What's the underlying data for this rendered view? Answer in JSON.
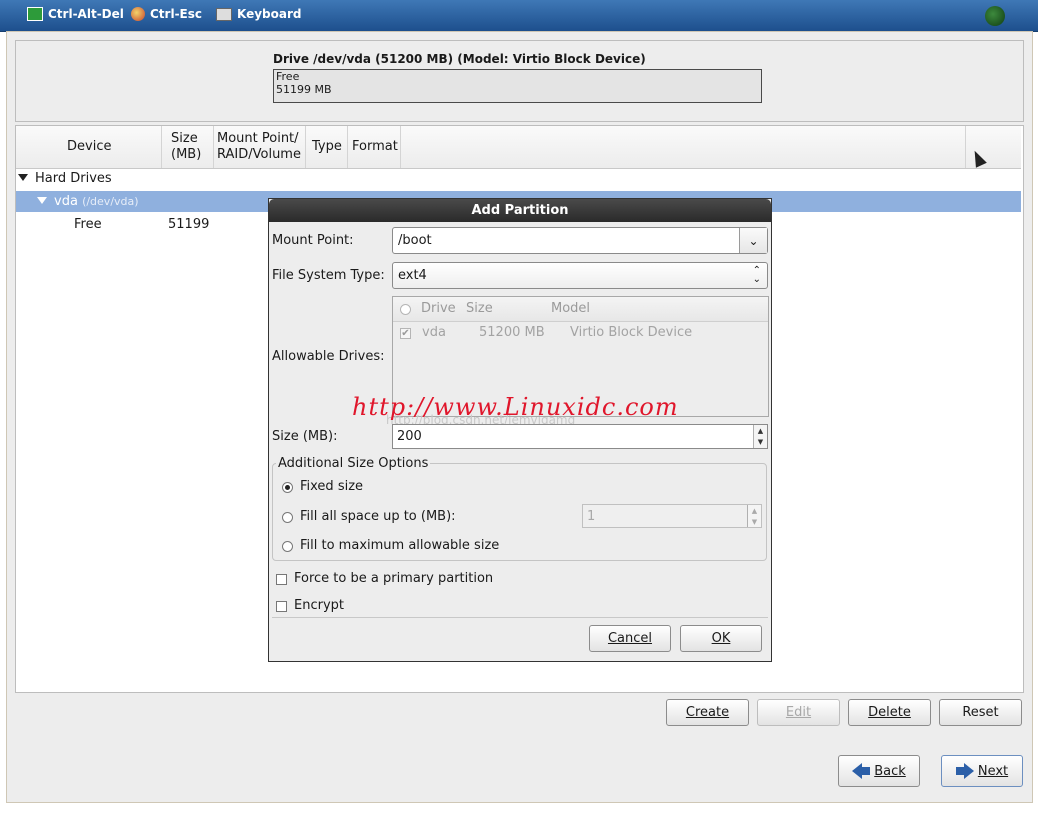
{
  "toolbar": {
    "items": [
      {
        "label": "Ctrl-Alt-Del",
        "icon": "monitor-icon"
      },
      {
        "label": "Ctrl-Esc",
        "icon": "windows-flag-icon"
      },
      {
        "label": "Keyboard",
        "icon": "keyboard-icon"
      }
    ],
    "status_icon": "connection-status-icon"
  },
  "drive": {
    "title": "Drive /dev/vda (51200 MB) (Model: Virtio Block Device)",
    "bar_label": "Free",
    "bar_size": "51199 MB"
  },
  "table": {
    "columns": [
      "Device",
      "Size\n(MB)",
      "Mount Point/\nRAID/Volume",
      "Type",
      "Format"
    ],
    "group": "Hard Drives",
    "disk": {
      "name": "vda",
      "path": "(/dev/vda)"
    },
    "free_row": {
      "device": "Free",
      "size": "51199"
    }
  },
  "dialog": {
    "title": "Add Partition",
    "mount_point_label": "Mount Point:",
    "mount_point_value": "/boot",
    "fs_type_label": "File System Type:",
    "fs_type_value": "ext4",
    "allowable_drives_label": "Allowable Drives:",
    "drives_columns": [
      "Drive",
      "Size",
      "Model"
    ],
    "drives": [
      {
        "drive": "vda",
        "size": "51200 MB",
        "model": "Virtio Block Device",
        "checked": true
      }
    ],
    "size_label": "Size (MB):",
    "size_value": "200",
    "size_options_label": "Additional Size Options",
    "opt_fixed": "Fixed size",
    "opt_fill_upto": "Fill all space up to (MB):",
    "opt_fill_upto_value": "1",
    "opt_fill_max": "Fill to maximum allowable size",
    "primary_label": "Force to be a primary partition",
    "encrypt_label": "Encrypt",
    "cancel_label": "Cancel",
    "ok_label": "OK"
  },
  "watermark": {
    "text": "http://www.Linuxidc.com",
    "subtext": "http://blog.csdn.net/jemvigamg"
  },
  "actions": {
    "create": "Create",
    "edit": "Edit",
    "delete": "Delete",
    "reset": "Reset"
  },
  "nav": {
    "back": "Back",
    "next": "Next"
  }
}
